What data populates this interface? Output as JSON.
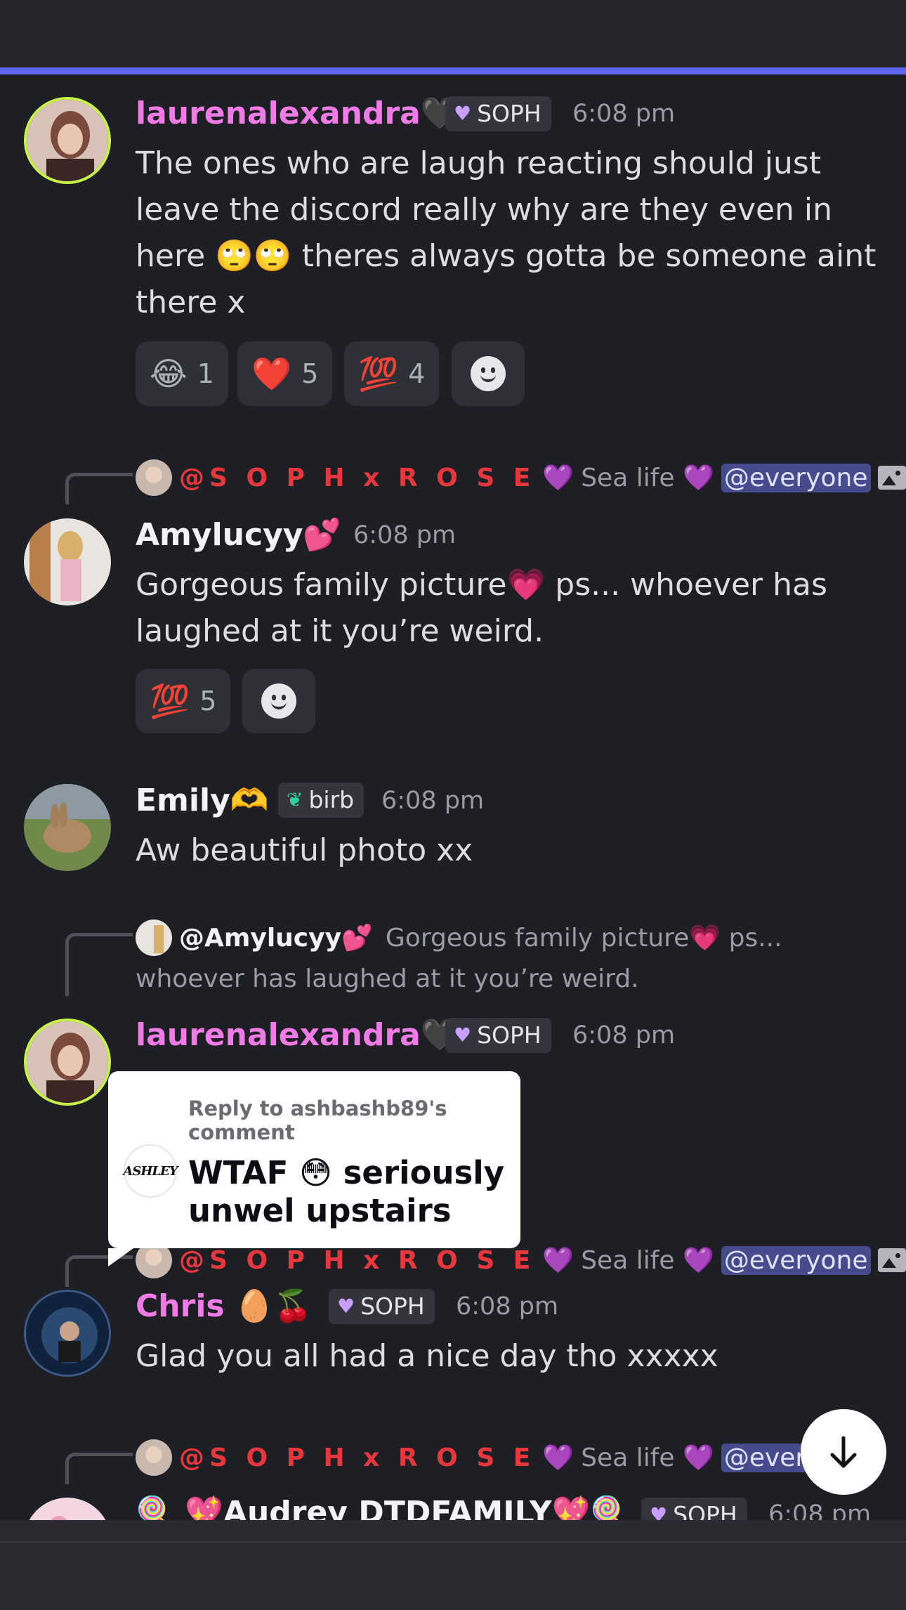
{
  "messages": [
    {
      "author": "laurenalexandra🖤",
      "role": "SOPH",
      "time": "6:08 pm",
      "text": "The ones who are laugh reacting should just leave the discord really why are they even in here 🙄🙄 theres always gotta be someone aint there x",
      "reactions": [
        {
          "emoji": "😂",
          "count": "1"
        },
        {
          "emoji": "❤️",
          "count": "5"
        },
        {
          "emoji": "💯",
          "count": "4"
        }
      ]
    },
    {
      "reply": {
        "author": "@S O P H x R O S E",
        "heart": "💜",
        "text": "Sea life 💜",
        "mention": "@everyone"
      },
      "author": "Amylucyy💕",
      "time": "6:08 pm",
      "text": "Gorgeous family picture💗 ps... whoever has laughed at it you’re weird.",
      "reactions": [
        {
          "emoji": "💯",
          "count": "5"
        }
      ]
    },
    {
      "author": "Emily🫶",
      "role": "birb",
      "time": "6:08 pm",
      "text": "Aw beautiful photo xx"
    },
    {
      "reply": {
        "author": "@Amylucyy💕",
        "text_line1": "Gorgeous family picture💗 ps...",
        "text_line2": "whoever has laughed at it you’re weird."
      },
      "author": "laurenalexandra🖤",
      "role": "SOPH",
      "time": "6:08 pm"
    },
    {
      "reply": {
        "author": "@S O P H x R O S E",
        "heart": "💜",
        "text": "Sea life 💜",
        "mention": "@everyone"
      },
      "author": "Chris 🥚🍒",
      "role": "SOPH",
      "time": "6:08 pm",
      "text": "Glad you all had a nice day tho xxxxx"
    },
    {
      "reply": {
        "author": "@S O P H x R O S E",
        "heart": "💜",
        "text": "Sea life 💜",
        "mention": "@everyone"
      },
      "author": "🍭 💖Audrey DTDFAMILY💖🍭",
      "role": "SOPH",
      "time": "6:08 pm"
    }
  ],
  "overlay": {
    "header": "Reply to ashbashb89's comment",
    "text": "WTAF 😳 seriously unwel upstairs",
    "avatar_text": "ASHLEY"
  },
  "colors": {
    "accent": "#5d65f1",
    "pink_name": "#f17be6",
    "mention_bg": "#454b8c"
  },
  "icons": {
    "scroll": "arrow-down-icon",
    "add_reaction": "add-reaction-icon",
    "image": "image-icon"
  }
}
